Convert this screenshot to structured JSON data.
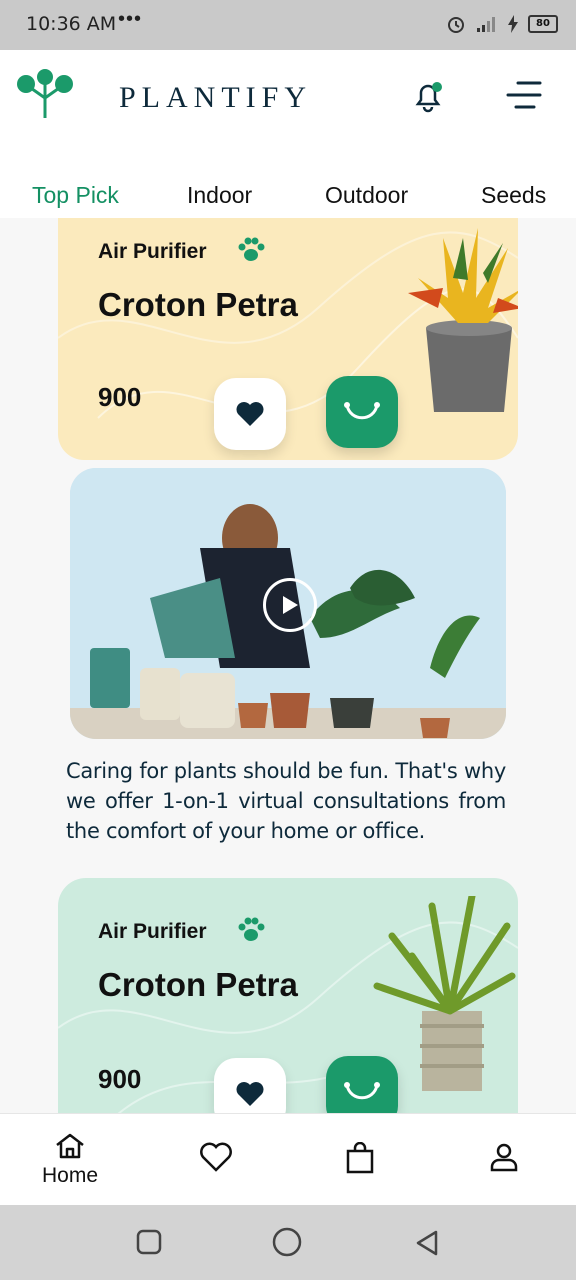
{
  "status": {
    "time": "10:36 AM",
    "dots": "•••",
    "battery": "80"
  },
  "header": {
    "brand": "PLANTIFY"
  },
  "tabs": [
    {
      "label": "Top Pick",
      "active": true
    },
    {
      "label": "Indoor"
    },
    {
      "label": "Outdoor"
    },
    {
      "label": "Seeds"
    }
  ],
  "products": [
    {
      "category": "Air Purifier",
      "name": "Croton Petra",
      "price": "900",
      "bg": "#fbeabd"
    },
    {
      "category": "Air Purifier",
      "name": "Croton Petra",
      "price": "900",
      "bg": "#cdebde"
    }
  ],
  "video": {
    "caption": "Caring for plants should be fun. That's why we offer 1-on-1 virtual consultations from the comfort of your home or office."
  },
  "bottom_nav": [
    {
      "label": "Home",
      "icon": "home-icon"
    },
    {
      "label": "",
      "icon": "heart-icon"
    },
    {
      "label": "",
      "icon": "bag-icon"
    },
    {
      "label": "",
      "icon": "user-icon"
    }
  ],
  "colors": {
    "accent": "#1b9a6a",
    "navy": "#0e2a3b"
  }
}
